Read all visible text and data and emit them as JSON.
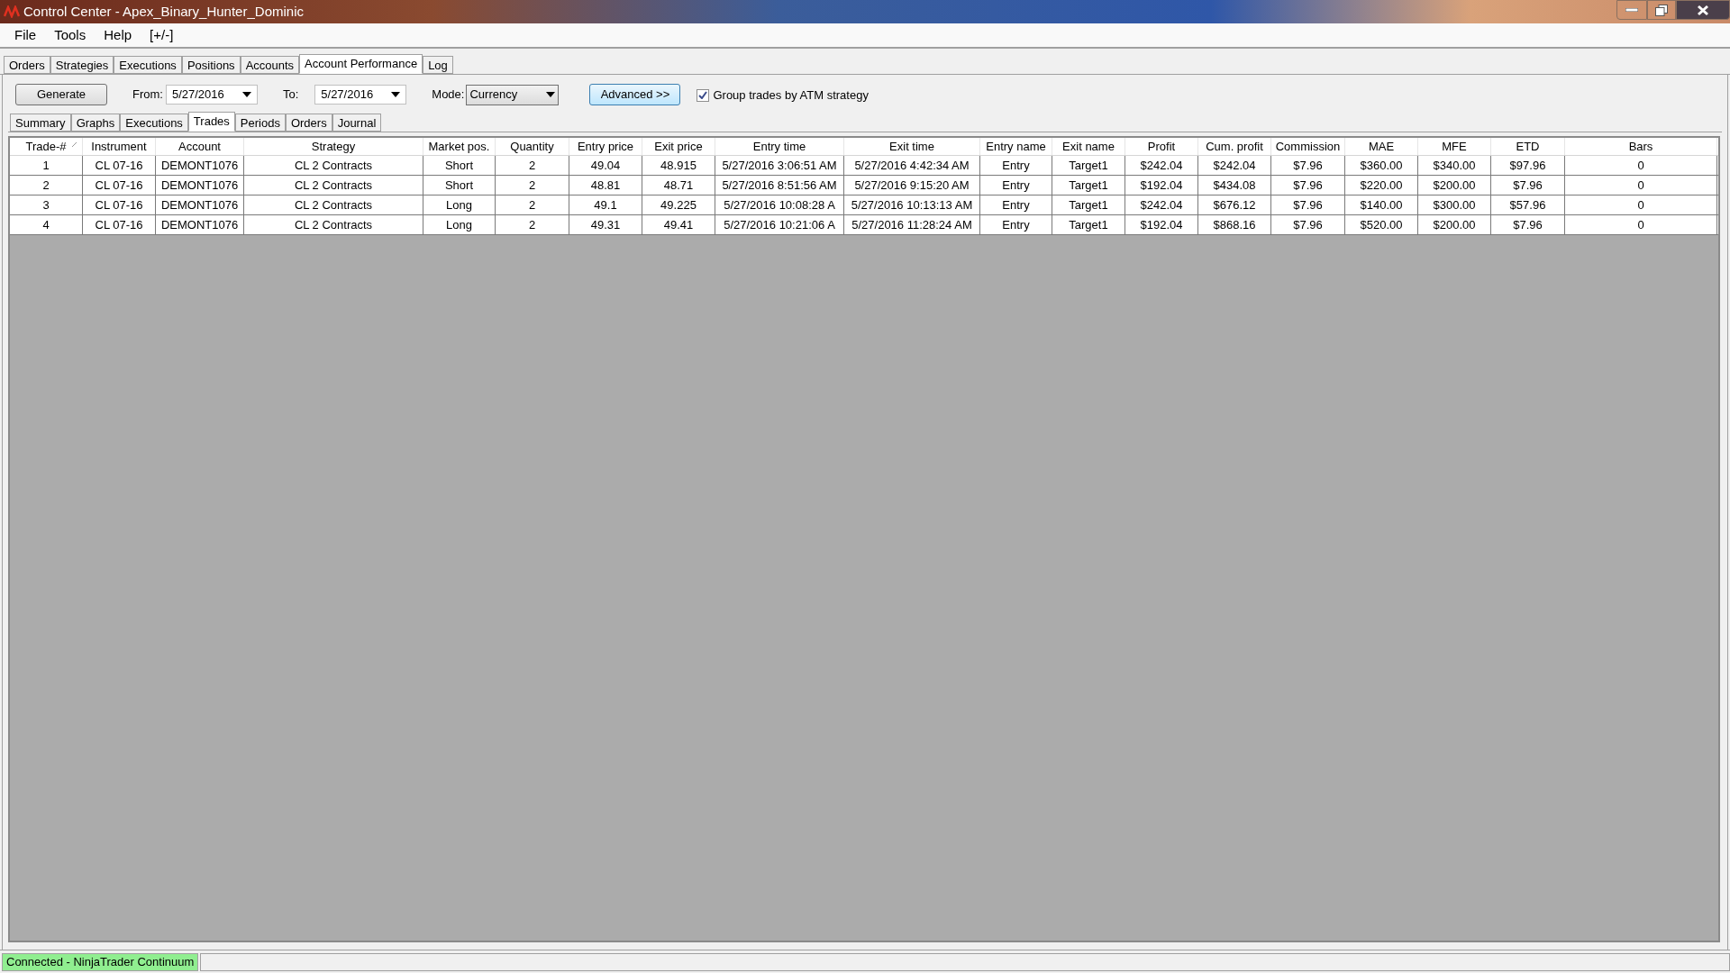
{
  "window": {
    "title": "Control Center - Apex_Binary_Hunter_Dominic"
  },
  "menu": [
    "File",
    "Tools",
    "Help",
    "[+/-]"
  ],
  "tabs": [
    {
      "label": "Orders",
      "selected": false
    },
    {
      "label": "Strategies",
      "selected": false
    },
    {
      "label": "Executions",
      "selected": false
    },
    {
      "label": "Positions",
      "selected": false
    },
    {
      "label": "Accounts",
      "selected": false
    },
    {
      "label": "Account Performance",
      "selected": true
    },
    {
      "label": "Log",
      "selected": false
    }
  ],
  "toolbar": {
    "generate": "Generate",
    "from_label": "From:",
    "from_value": "5/27/2016",
    "to_label": "To:",
    "to_value": "5/27/2016",
    "mode_label": "Mode:",
    "mode_value": "Currency",
    "advanced": "Advanced >>",
    "group_checkbox": {
      "label": "Group trades by ATM strategy",
      "checked": true
    }
  },
  "subtabs": [
    {
      "label": "Summary",
      "selected": false
    },
    {
      "label": "Graphs",
      "selected": false
    },
    {
      "label": "Executions",
      "selected": false
    },
    {
      "label": "Trades",
      "selected": true
    },
    {
      "label": "Periods",
      "selected": false
    },
    {
      "label": "Orders",
      "selected": false
    },
    {
      "label": "Journal",
      "selected": false
    }
  ],
  "table": {
    "columns": [
      "Trade-#",
      "Instrument",
      "Account",
      "Strategy",
      "Market pos.",
      "Quantity",
      "Entry price",
      "Exit price",
      "Entry time",
      "Exit time",
      "Entry name",
      "Exit name",
      "Profit",
      "Cum. profit",
      "Commission",
      "MAE",
      "MFE",
      "ETD",
      "Bars"
    ],
    "rows": [
      [
        "1",
        "CL 07-16",
        "DEMONT1076",
        "CL 2 Contracts",
        "Short",
        "2",
        "49.04",
        "48.915",
        "5/27/2016 3:06:51 AM",
        "5/27/2016 4:42:34 AM",
        "Entry",
        "Target1",
        "$242.04",
        "$242.04",
        "$7.96",
        "$360.00",
        "$340.00",
        "$97.96",
        "0"
      ],
      [
        "2",
        "CL 07-16",
        "DEMONT1076",
        "CL 2 Contracts",
        "Short",
        "2",
        "48.81",
        "48.71",
        "5/27/2016 8:51:56 AM",
        "5/27/2016 9:15:20 AM",
        "Entry",
        "Target1",
        "$192.04",
        "$434.08",
        "$7.96",
        "$220.00",
        "$200.00",
        "$7.96",
        "0"
      ],
      [
        "3",
        "CL 07-16",
        "DEMONT1076",
        "CL 2 Contracts",
        "Long",
        "2",
        "49.1",
        "49.225",
        "5/27/2016 10:08:28 A",
        "5/27/2016 10:13:13 AM",
        "Entry",
        "Target1",
        "$242.04",
        "$676.12",
        "$7.96",
        "$140.00",
        "$300.00",
        "$57.96",
        "0"
      ],
      [
        "4",
        "CL 07-16",
        "DEMONT1076",
        "CL 2 Contracts",
        "Long",
        "2",
        "49.31",
        "49.41",
        "5/27/2016 10:21:06 A",
        "5/27/2016 11:28:24 AM",
        "Entry",
        "Target1",
        "$192.04",
        "$868.16",
        "$7.96",
        "$520.00",
        "$200.00",
        "$7.96",
        "0"
      ]
    ]
  },
  "status_bar": {
    "connection": "Connected - NinjaTrader Continuum"
  }
}
